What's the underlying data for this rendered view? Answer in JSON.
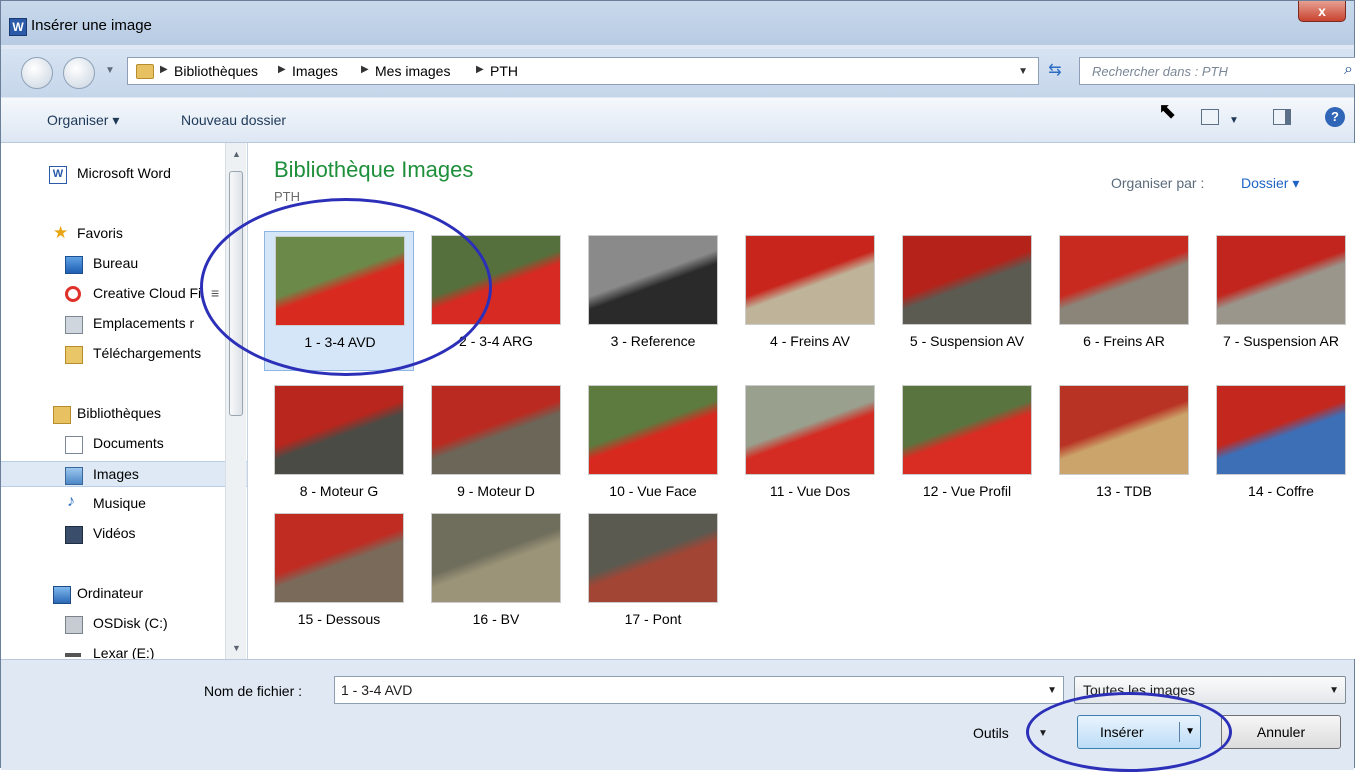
{
  "window": {
    "title": "Insérer une image",
    "close": "x",
    "app_icon": "W"
  },
  "address": {
    "crumbs": [
      "Bibliothèques",
      "Images",
      "Mes images",
      "PTH"
    ],
    "search_placeholder": "Rechercher dans : PTH"
  },
  "toolbar": {
    "organize": "Organiser ▾",
    "new_folder": "Nouveau dossier",
    "help": "?"
  },
  "sidebar": {
    "items": [
      {
        "label": "Microsoft Word",
        "icon": "word-icon"
      },
      {
        "label": "Favoris",
        "icon": "star-icon"
      },
      {
        "label": "Bureau",
        "icon": "desktop-icon"
      },
      {
        "label": "Creative Cloud Fi",
        "icon": "creative-cloud-icon"
      },
      {
        "label": "Emplacements r",
        "icon": "places-icon"
      },
      {
        "label": "Téléchargements",
        "icon": "downloads-icon"
      },
      {
        "label": "Bibliothèques",
        "icon": "libraries-icon"
      },
      {
        "label": "Documents",
        "icon": "documents-icon"
      },
      {
        "label": "Images",
        "icon": "images-icon"
      },
      {
        "label": "Musique",
        "icon": "music-icon"
      },
      {
        "label": "Vidéos",
        "icon": "videos-icon"
      },
      {
        "label": "Ordinateur",
        "icon": "computer-icon"
      },
      {
        "label": "OSDisk (C:)",
        "icon": "disk-icon"
      },
      {
        "label": "Lexar (E:)",
        "icon": "drive-icon"
      }
    ]
  },
  "content": {
    "title": "Bibliothèque Images",
    "subtitle": "PTH",
    "organize_by_label": "Organiser par :",
    "organize_by_value": "Dossier ▾",
    "files": [
      {
        "label": "1 - 3-4 AVD",
        "colors": [
          "#6b8a4a",
          "#d92a20"
        ]
      },
      {
        "label": "2 - 3-4 ARG",
        "colors": [
          "#55703c",
          "#d62a22"
        ]
      },
      {
        "label": "3 - Reference",
        "colors": [
          "#8a8a8a",
          "#2a2a2a"
        ]
      },
      {
        "label": "4 - Freins AV",
        "colors": [
          "#c8251c",
          "#bfb49a"
        ]
      },
      {
        "label": "5 - Suspension AV",
        "colors": [
          "#b52219",
          "#5b5b52"
        ]
      },
      {
        "label": "6 - Freins AR",
        "colors": [
          "#c92a20",
          "#8a8578"
        ]
      },
      {
        "label": "7 - Suspension AR",
        "colors": [
          "#c2251d",
          "#9a968c"
        ]
      },
      {
        "label": "8 - Moteur G",
        "colors": [
          "#b8261d",
          "#4b4b45"
        ]
      },
      {
        "label": "9 - Moteur D",
        "colors": [
          "#bb2a20",
          "#6b6658"
        ]
      },
      {
        "label": "10 - Vue Face",
        "colors": [
          "#5d7a3f",
          "#d8291f"
        ]
      },
      {
        "label": "11 - Vue Dos",
        "colors": [
          "#9aa08e",
          "#d42b22"
        ]
      },
      {
        "label": "12 - Vue Profil",
        "colors": [
          "#5a7440",
          "#d92c23"
        ]
      },
      {
        "label": "13 - TDB",
        "colors": [
          "#b93325",
          "#caa46a"
        ]
      },
      {
        "label": "14 - Coffre",
        "colors": [
          "#c4271e",
          "#3d6fb7"
        ]
      },
      {
        "label": "15 - Dessous",
        "colors": [
          "#c02b22",
          "#7a6a5a"
        ]
      },
      {
        "label": "16 - BV",
        "colors": [
          "#6f6d5c",
          "#9b9478"
        ]
      },
      {
        "label": "17 - Pont",
        "colors": [
          "#5a5a50",
          "#a34535"
        ]
      }
    ]
  },
  "bottom": {
    "filename_label": "Nom de fichier :",
    "filename_value": "1 - 3-4 AVD",
    "filetype_value": "Toutes les images",
    "tools_label": "Outils",
    "insert_label": "Insérer",
    "cancel_label": "Annuler"
  }
}
